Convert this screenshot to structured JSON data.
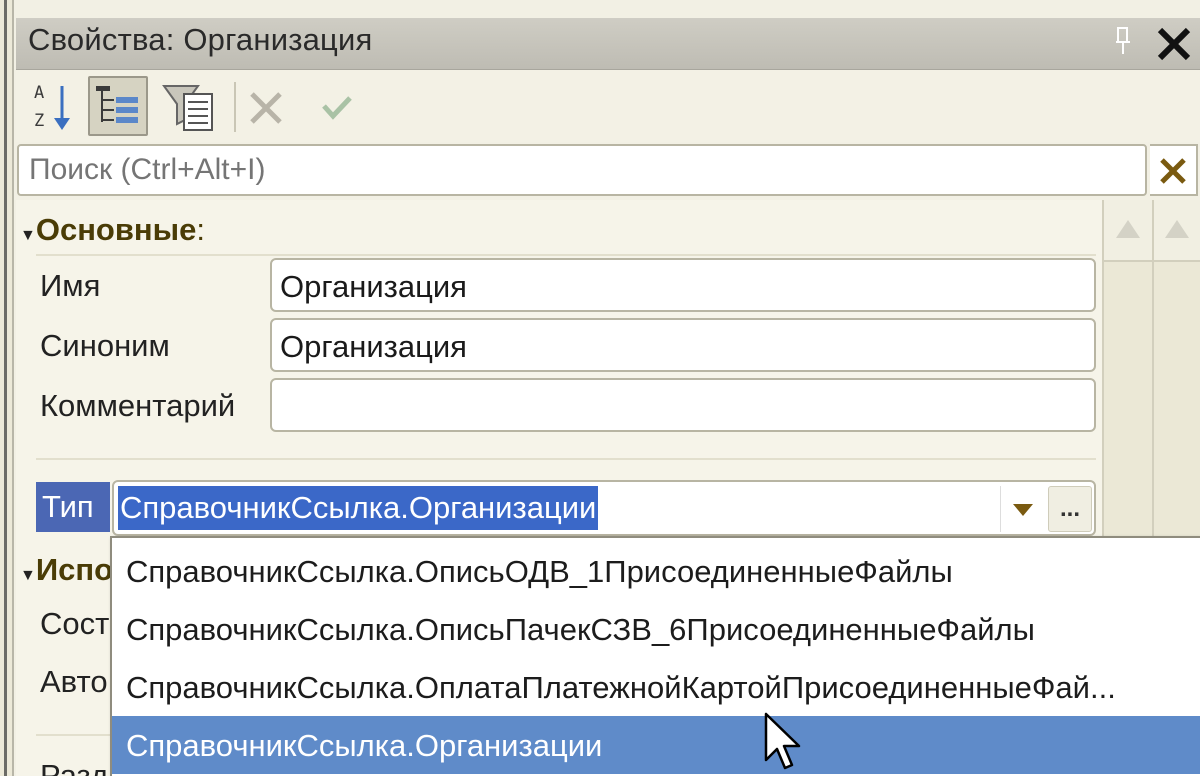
{
  "window": {
    "title": "Свойства: Организация"
  },
  "search": {
    "placeholder": "Поиск (Ctrl+Alt+I)"
  },
  "sections": {
    "main": {
      "label": "Основные",
      "colon": ":"
    },
    "usage": {
      "label_visible": "Испо"
    }
  },
  "properties": {
    "name": {
      "label": "Имя",
      "value": "Организация"
    },
    "synonym": {
      "label": "Синоним",
      "value": "Организация"
    },
    "comment": {
      "label": "Комментарий",
      "value": ""
    },
    "type": {
      "label": "Тип",
      "value": "СправочникСсылка.Организации",
      "more_label": "..."
    }
  },
  "partial_labels": {
    "row1": "Сост",
    "row2": "Авто",
    "row3": "Разд"
  },
  "dropdown": {
    "items": [
      "СправочникСсылка.ОписьОДВ_1ПрисоединенныеФайлы",
      "СправочникСсылка.ОписьПачекСЗВ_6ПрисоединенныеФайлы",
      "СправочникСсылка.ОплатаПлатежнойКартойПрисоединенныеФай...",
      "СправочникСсылка.Организации"
    ],
    "selected_index": 3
  },
  "colors": {
    "selection_blue": "#3b68c8",
    "list_highlight": "#5f8bc9",
    "section_text": "#4a3c06",
    "panel_bg": "#f3f1e5"
  }
}
